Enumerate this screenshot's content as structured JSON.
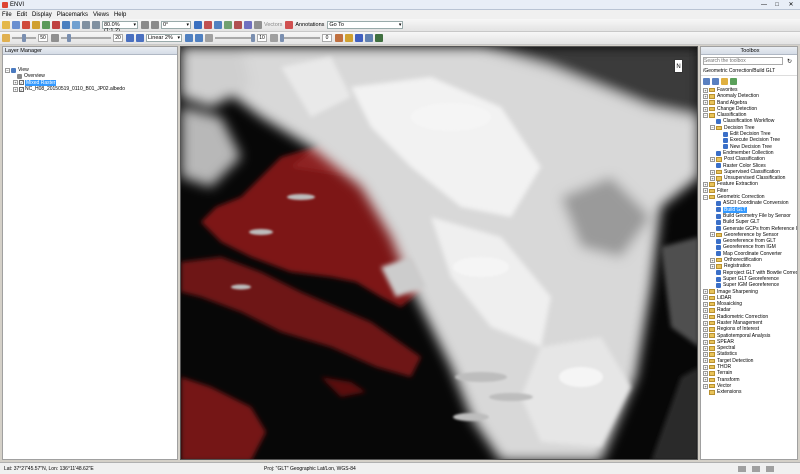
{
  "window": {
    "title": "ENVI",
    "minimize": "—",
    "maximize": "□",
    "close": "✕"
  },
  "menu": [
    "File",
    "Edit",
    "Display",
    "Placemarks",
    "Views",
    "Help"
  ],
  "toolbar1": {
    "zoom": "80.0% (1:1.2)",
    "rotation": "0°",
    "vectors": "Vectors",
    "annotations": "Annotations",
    "goto": "Go To"
  },
  "toolbar2": {
    "brightness": "50",
    "contrast": "20",
    "stretch": "Linear 2%",
    "sharpen": "10",
    "transparency": "0"
  },
  "layer_manager": {
    "title": "Layer Manager",
    "items": [
      "View",
      "Overview",
      "Mixed Raster",
      "NC_H08_20150519_0110_B01_JP02.albedo"
    ]
  },
  "toolbox": {
    "title": "Toolbox",
    "search_placeholder": "Search the toolbox",
    "path": "/Geometric Correction/Build GLT",
    "items": [
      {
        "label": "Favorites",
        "level": 0,
        "type": "folder",
        "exp": "+"
      },
      {
        "label": "Anomaly Detection",
        "level": 0,
        "type": "folder",
        "exp": "+"
      },
      {
        "label": "Band Algebra",
        "level": 0,
        "type": "folder",
        "exp": "+"
      },
      {
        "label": "Change Detection",
        "level": 0,
        "type": "folder",
        "exp": "+"
      },
      {
        "label": "Classification",
        "level": 0,
        "type": "folder",
        "exp": "−"
      },
      {
        "label": "Classification Workflow",
        "level": 1,
        "type": "tool"
      },
      {
        "label": "Decision Tree",
        "level": 1,
        "type": "folder",
        "exp": "−"
      },
      {
        "label": "Edit Decision Tree",
        "level": 2,
        "type": "tool"
      },
      {
        "label": "Execute Decision Tree",
        "level": 2,
        "type": "tool"
      },
      {
        "label": "New Decision Tree",
        "level": 2,
        "type": "tool"
      },
      {
        "label": "Endmember Collection",
        "level": 1,
        "type": "tool"
      },
      {
        "label": "Post Classification",
        "level": 1,
        "type": "folder",
        "exp": "+"
      },
      {
        "label": "Raster Color Slices",
        "level": 1,
        "type": "tool"
      },
      {
        "label": "Supervised Classification",
        "level": 1,
        "type": "folder",
        "exp": "+"
      },
      {
        "label": "Unsupervised Classification",
        "level": 1,
        "type": "folder",
        "exp": "+"
      },
      {
        "label": "Feature Extraction",
        "level": 0,
        "type": "folder",
        "exp": "+"
      },
      {
        "label": "Filter",
        "level": 0,
        "type": "folder",
        "exp": "+"
      },
      {
        "label": "Geometric Correction",
        "level": 0,
        "type": "folder",
        "exp": "−"
      },
      {
        "label": "ASCII Coordinate Conversion",
        "level": 1,
        "type": "tool"
      },
      {
        "label": "Build GLT",
        "level": 1,
        "type": "tool",
        "selected": true
      },
      {
        "label": "Build Geometry File by Sensor",
        "level": 1,
        "type": "tool"
      },
      {
        "label": "Build Super GLT",
        "level": 1,
        "type": "tool"
      },
      {
        "label": "Generate GCPs from Reference Ima",
        "level": 1,
        "type": "tool"
      },
      {
        "label": "Georeference by Sensor",
        "level": 1,
        "type": "folder",
        "exp": "+"
      },
      {
        "label": "Georeference from GLT",
        "level": 1,
        "type": "tool"
      },
      {
        "label": "Georeference from IGM",
        "level": 1,
        "type": "tool"
      },
      {
        "label": "Map Coordinate Converter",
        "level": 1,
        "type": "tool"
      },
      {
        "label": "Orthorectification",
        "level": 1,
        "type": "folder",
        "exp": "+"
      },
      {
        "label": "Registration",
        "level": 1,
        "type": "folder",
        "exp": "+"
      },
      {
        "label": "Reproject GLT with Bowtie Correctio",
        "level": 1,
        "type": "tool"
      },
      {
        "label": "Super GLT Georeference",
        "level": 1,
        "type": "tool"
      },
      {
        "label": "Super IGM Georeference",
        "level": 1,
        "type": "tool"
      },
      {
        "label": "Image Sharpening",
        "level": 0,
        "type": "folder",
        "exp": "+"
      },
      {
        "label": "LiDAR",
        "level": 0,
        "type": "folder",
        "exp": "+"
      },
      {
        "label": "Mosaicking",
        "level": 0,
        "type": "folder",
        "exp": "+"
      },
      {
        "label": "Radar",
        "level": 0,
        "type": "folder",
        "exp": "+"
      },
      {
        "label": "Radiometric Correction",
        "level": 0,
        "type": "folder",
        "exp": "+"
      },
      {
        "label": "Raster Management",
        "level": 0,
        "type": "folder",
        "exp": "+"
      },
      {
        "label": "Regions of Interest",
        "level": 0,
        "type": "folder",
        "exp": "+"
      },
      {
        "label": "Spatiotemporal Analysis",
        "level": 0,
        "type": "folder",
        "exp": "+"
      },
      {
        "label": "SPEAR",
        "level": 0,
        "type": "folder",
        "exp": "+"
      },
      {
        "label": "Spectral",
        "level": 0,
        "type": "folder",
        "exp": "+"
      },
      {
        "label": "Statistics",
        "level": 0,
        "type": "folder",
        "exp": "+"
      },
      {
        "label": "Target Detection",
        "level": 0,
        "type": "folder",
        "exp": "+"
      },
      {
        "label": "THOR",
        "level": 0,
        "type": "folder",
        "exp": "+"
      },
      {
        "label": "Terrain",
        "level": 0,
        "type": "folder",
        "exp": "+"
      },
      {
        "label": "Transform",
        "level": 0,
        "type": "folder",
        "exp": "+"
      },
      {
        "label": "Vector",
        "level": 0,
        "type": "folder",
        "exp": "+"
      },
      {
        "label": "Extensions",
        "level": 0,
        "type": "folder",
        "exp": ""
      }
    ]
  },
  "canvas": {
    "north": "N"
  },
  "status": {
    "coords": "Lat: 37°27'45.57\"N, Lon: 136°11'48.62\"E",
    "projection": "Proj: \"GLT\" Geographic Lat/Lon, WGS-84"
  },
  "colors": {
    "cloud": "#e8e8e8",
    "land": "#8c1c1c",
    "sea": "#0a0a0a",
    "selection": "#3399ff"
  }
}
